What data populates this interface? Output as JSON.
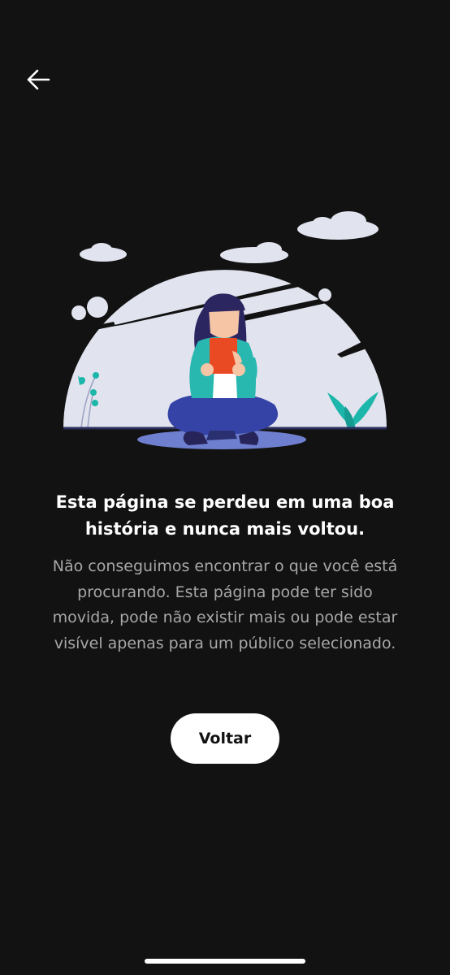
{
  "nav": {
    "back_icon": "arrow-left-icon"
  },
  "illustration": {
    "subject": "person-reading-book",
    "colors": {
      "dome": "#e1e3ee",
      "shadow": "#6f7fcf",
      "hair": "#2b2660",
      "skin": "#f6c5a6",
      "shirt": "#28b8b0",
      "book": "#ea4a23",
      "pants": "#3543a6",
      "plant": "#1cb6ab"
    }
  },
  "content": {
    "title": "Esta página se perdeu em uma boa história e nunca mais voltou.",
    "message": "Não conseguimos encontrar o que você está procurando. Esta página pode ter sido movida, pode não existir mais ou pode estar visível apenas para um público selecionado."
  },
  "actions": {
    "back_label": "Voltar"
  }
}
